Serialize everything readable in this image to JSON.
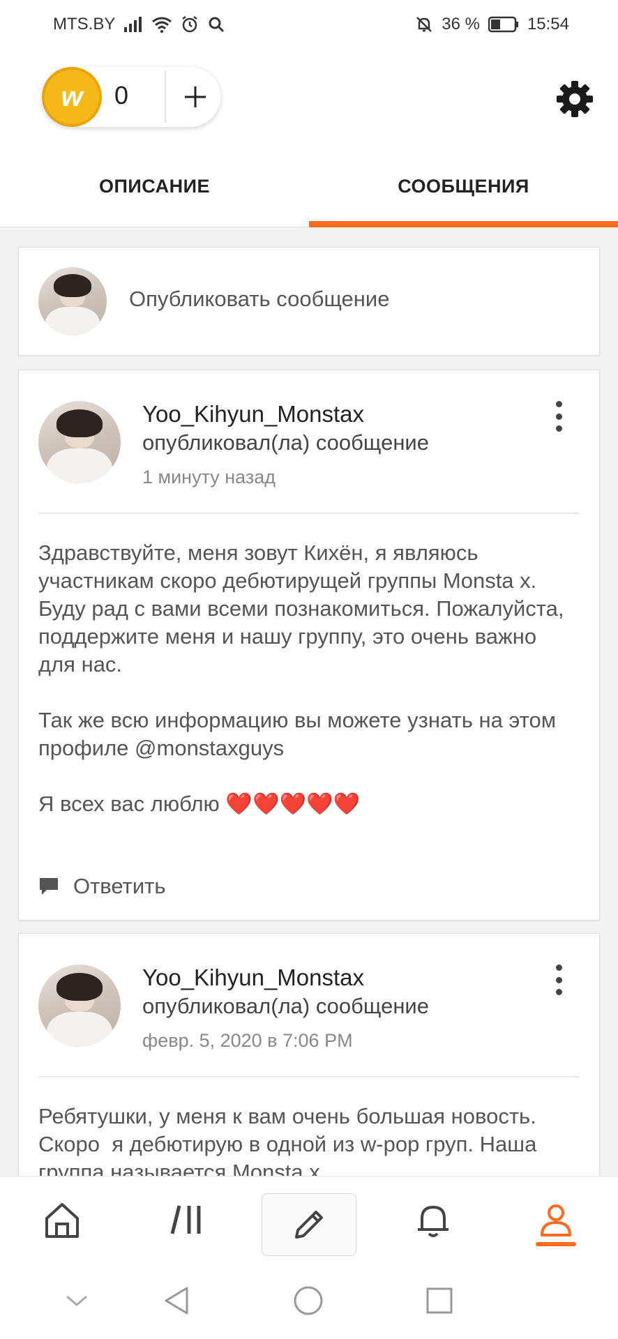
{
  "status_bar": {
    "carrier": "MTS.BY",
    "battery": "36 %",
    "time": "15:54",
    "icons": [
      "signal-icon",
      "wifi-icon",
      "alarm-icon",
      "search-icon",
      "mute-icon",
      "battery-icon"
    ]
  },
  "header": {
    "coin_count": "0",
    "coin_letter": "w",
    "icons": [
      "coin-icon",
      "plus-icon",
      "gear-icon"
    ],
    "accent_color": "#ff6a1f"
  },
  "tabs": [
    {
      "label": "ОПИСАНИЕ",
      "active": false
    },
    {
      "label": "СООБЩЕНИЯ",
      "active": true
    }
  ],
  "compose": {
    "placeholder": "Опубликовать сообщение"
  },
  "messages": [
    {
      "author": "Yoo_Kihyun_Monstax",
      "action": "опубликовал(ла) сообщение",
      "time": "1 минуту назад",
      "paragraphs": [
        "Здравствуйте, меня зовут Кихён, я являюсь участникам скоро дебютирущей группы Monsta x. Буду рад с вами всеми познакомиться. Пожалуйста, поддержите меня и нашу группу, это очень важно для нас.",
        "Так же всю информацию вы можете узнать на этом профиле @monstaxguys",
        "Я всех вас люблю ❤️❤️❤️❤️❤️"
      ],
      "reply_label": "Ответить"
    },
    {
      "author": "Yoo_Kihyun_Monstax",
      "action": "опубликовал(ла) сообщение",
      "time": "февр. 5, 2020 в 7:06 PM",
      "paragraphs": [
        "Ребятушки, у меня к вам очень большая новость. Скоро  я дебютирую в одной из w-pop груп. Наша группа называется Monsta x"
      ]
    }
  ],
  "bottom_nav": {
    "items": [
      "home-icon",
      "library-icon",
      "write-icon",
      "notifications-icon",
      "profile-icon"
    ],
    "active": "profile-icon"
  },
  "system_nav": [
    "hide-keyboard-icon",
    "back-icon",
    "home-circle-icon",
    "recents-icon"
  ]
}
